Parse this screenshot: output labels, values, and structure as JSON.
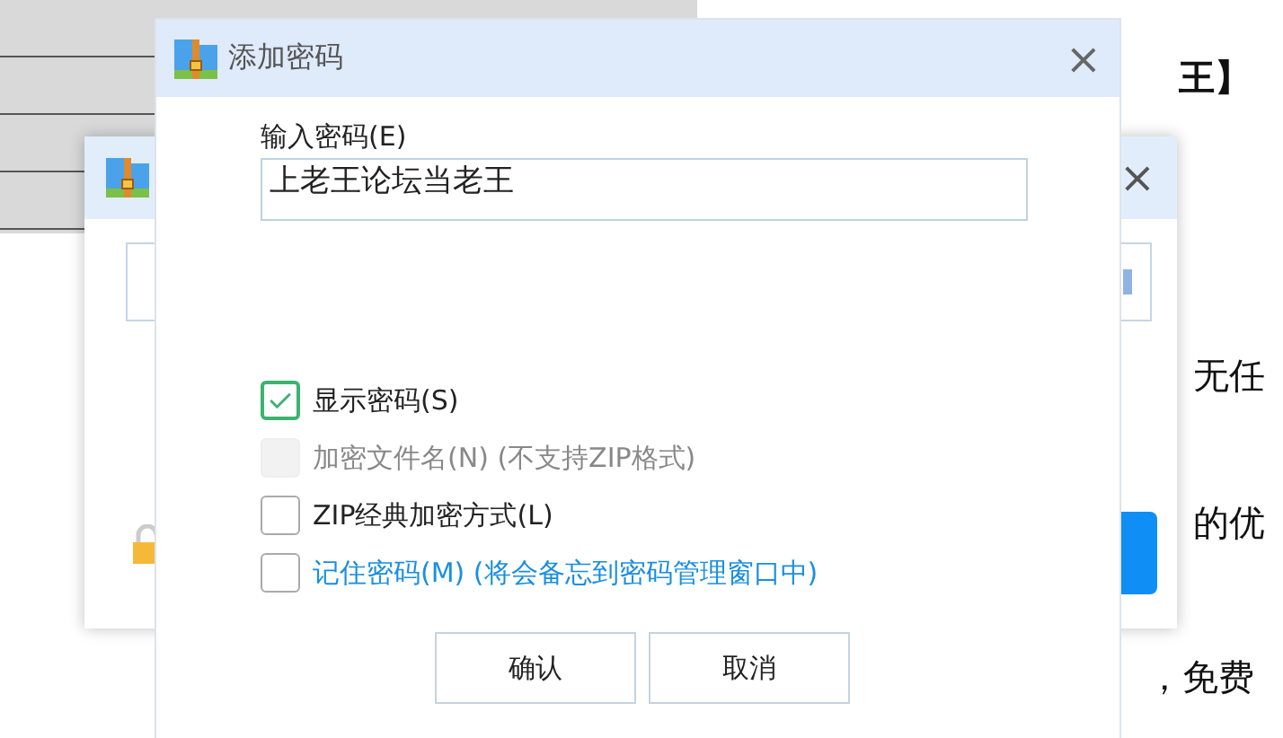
{
  "background": {
    "texts": [
      "王】",
      "无任",
      "的优",
      "，免费"
    ]
  },
  "back_window": {
    "close": "×"
  },
  "dialog": {
    "title": "添加密码",
    "close": "×",
    "password_label": "输入密码(E)",
    "password_value": "上老王论坛当老王",
    "options": [
      {
        "label": "显示密码(S)",
        "checked": true,
        "disabled": false,
        "kind": "normal"
      },
      {
        "label": "加密文件名(N) (不支持ZIP格式)",
        "checked": false,
        "disabled": true,
        "kind": "normal"
      },
      {
        "label": "ZIP经典加密方式(L)",
        "checked": false,
        "disabled": false,
        "kind": "normal"
      },
      {
        "label": "记住密码(M) (将会备忘到密码管理窗口中)",
        "checked": false,
        "disabled": false,
        "kind": "link"
      }
    ],
    "buttons": [
      "确认",
      "取消"
    ]
  }
}
